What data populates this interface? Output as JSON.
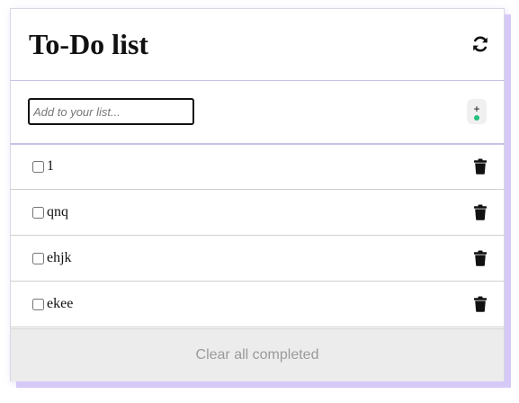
{
  "header": {
    "title": "To-Do list",
    "refresh_icon": "refresh-icon"
  },
  "add": {
    "placeholder": "Add to your list...",
    "value": "",
    "button_label": "+",
    "status_dot_color": "#22c07e"
  },
  "items": [
    {
      "label": "1",
      "checked": false,
      "delete_icon": "trash-icon"
    },
    {
      "label": "qnq",
      "checked": false,
      "delete_icon": "trash-icon"
    },
    {
      "label": "ehjk",
      "checked": false,
      "delete_icon": "trash-icon"
    },
    {
      "label": "ekee",
      "checked": false,
      "delete_icon": "trash-icon"
    }
  ],
  "footer": {
    "clear_label": "Clear all completed"
  },
  "colors": {
    "accent_shadow": "#d6c8f7",
    "divider": "#c9bfe8",
    "footer_bg": "#ececec",
    "footer_text": "#9a9a9a"
  }
}
